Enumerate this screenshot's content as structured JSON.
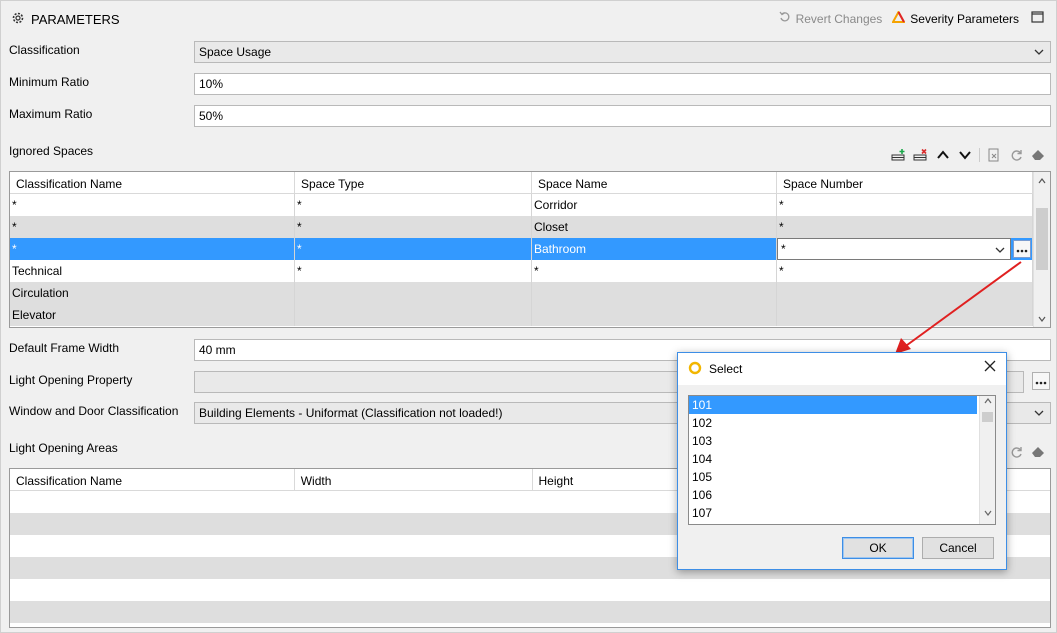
{
  "header": {
    "title": "PARAMETERS",
    "revert_label": "Revert Changes",
    "severity_label": "Severity Parameters"
  },
  "form": {
    "classification": {
      "label": "Classification",
      "value": "Space Usage"
    },
    "min_ratio": {
      "label": "Minimum Ratio",
      "value": "10%"
    },
    "max_ratio": {
      "label": "Maximum Ratio",
      "value": "50%"
    },
    "ignored_spaces_label": "Ignored Spaces",
    "default_frame_width": {
      "label": "Default Frame Width",
      "value": "40 mm"
    },
    "light_opening_property": {
      "label": "Light Opening Property",
      "value": ""
    },
    "window_door_classification": {
      "label": "Window and Door Classification",
      "value": "Building Elements - Uniformat (Classification not loaded!)"
    },
    "light_opening_areas_label": "Light Opening Areas"
  },
  "ignored_table": {
    "columns": [
      "Classification Name",
      "Space Type",
      "Space Name",
      "Space Number"
    ],
    "rows": [
      [
        "*",
        "*",
        "Corridor",
        "*"
      ],
      [
        "*",
        "*",
        "Closet",
        "*"
      ],
      [
        "*",
        "*",
        "Bathroom",
        "*"
      ],
      [
        "Technical",
        "*",
        "*",
        "*"
      ],
      [
        "Circulation",
        "",
        "",
        ""
      ],
      [
        "Elevator",
        "",
        "",
        ""
      ]
    ],
    "selected_row": 2
  },
  "areas_table": {
    "columns": [
      "Classification Name",
      "Width",
      "Height"
    ]
  },
  "dialog": {
    "title": "Select",
    "items": [
      "101",
      "102",
      "103",
      "104",
      "105",
      "106",
      "107"
    ],
    "selected": "101",
    "ok_label": "OK",
    "cancel_label": "Cancel"
  },
  "colors": {
    "selection": "#3399ff",
    "arrow": "#e02020",
    "severity_accent": "#f5a300"
  }
}
